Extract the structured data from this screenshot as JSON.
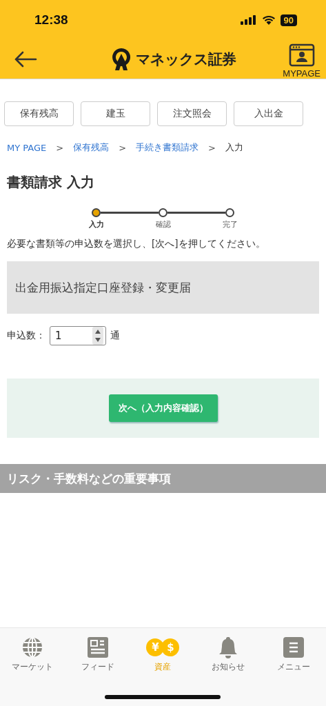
{
  "status_bar": {
    "time": "12:38",
    "battery": "90"
  },
  "header": {
    "logo_text": "マネックス証券",
    "mypage_label": "MYPAGE"
  },
  "tabs": [
    {
      "label": "保有残高"
    },
    {
      "label": "建玉"
    },
    {
      "label": "注文照会"
    },
    {
      "label": "入出金"
    }
  ],
  "breadcrumb": [
    {
      "label": "MY PAGE",
      "link": true
    },
    {
      "label": "保有残高",
      "link": true
    },
    {
      "label": "手続き書類請求",
      "link": true
    },
    {
      "label": "入力",
      "link": false
    }
  ],
  "breadcrumb_separator": ">",
  "title": "書類請求 入力",
  "steps": [
    {
      "label": "入力",
      "selected": true
    },
    {
      "label": "確認",
      "selected": false
    },
    {
      "label": "完了",
      "selected": false
    }
  ],
  "instruction": "必要な書類等の申込数を選択し、[次へ]を押してください。",
  "document": {
    "name": "出金用振込指定口座登録・変更届",
    "quantity_label": "申込数：",
    "quantity": "1",
    "unit": "通"
  },
  "next_button": "次へ（入力内容確認）",
  "risk_heading": "リスク・手数料などの重要事項",
  "bottom_nav": [
    {
      "kind": "globe",
      "label": "マーケット",
      "selected": false
    },
    {
      "kind": "feed",
      "label": "フィード",
      "selected": false
    },
    {
      "kind": "coins",
      "label": "資産",
      "selected": true,
      "glyphs": [
        "¥",
        "$"
      ]
    },
    {
      "kind": "bell",
      "label": "お知らせ",
      "selected": false
    },
    {
      "kind": "menu",
      "label": "メニュー",
      "selected": false
    }
  ]
}
